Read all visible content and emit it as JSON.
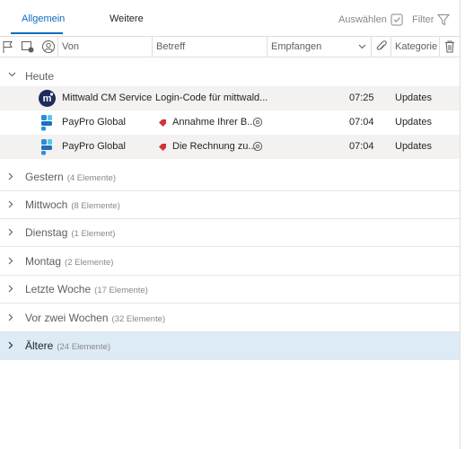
{
  "tabs": [
    {
      "label": "Allgemein",
      "active": true
    },
    {
      "label": "Weitere",
      "active": false
    }
  ],
  "toolbar": {
    "select_label": "Auswählen",
    "filter_label": "Filter"
  },
  "columns": {
    "from": "Von",
    "subject": "Betreff",
    "received": "Empfangen",
    "category": "Kategorie"
  },
  "today_group": {
    "name": "Heute"
  },
  "mails": [
    {
      "from": "Mittwald CM Service",
      "subject": "Login-Code für mittwald...",
      "time": "07:25",
      "category": "Updates",
      "avatar_icon": "mittwald-logo-icon",
      "tagged": false
    },
    {
      "from": "PayPro Global",
      "subject": "Annahme Ihrer B...",
      "time": "07:04",
      "category": "Updates",
      "avatar_icon": "paypro-logo-icon",
      "tagged": true
    },
    {
      "from": "PayPro Global",
      "subject": "Die Rechnung zu...",
      "time": "07:04",
      "category": "Updates",
      "avatar_icon": "paypro-logo-icon",
      "tagged": true
    }
  ],
  "groups": [
    {
      "name": "Gestern",
      "count": "(4 Elemente)"
    },
    {
      "name": "Mittwoch",
      "count": "(8 Elemente)"
    },
    {
      "name": "Dienstag",
      "count": "(1 Element)"
    },
    {
      "name": "Montag",
      "count": "(2 Elemente)"
    },
    {
      "name": "Letzte Woche",
      "count": "(17 Elemente)"
    },
    {
      "name": "Vor zwei Wochen",
      "count": "(32 Elemente)"
    },
    {
      "name": "Ältere",
      "count": "(24 Elemente)",
      "selected": true
    }
  ],
  "colors": {
    "accent": "#0f6cbd",
    "selection": "#ddebf7",
    "tag_red": "#d13438"
  }
}
